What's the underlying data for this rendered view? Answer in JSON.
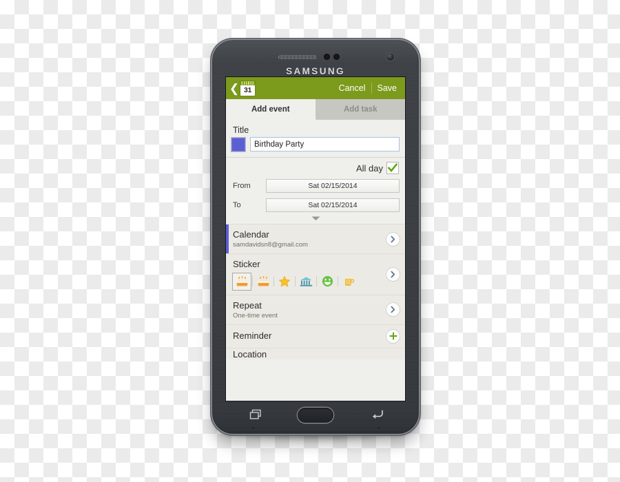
{
  "device": {
    "brand": "SAMSUNG",
    "icons": {
      "earpiece": "earpiece-grille",
      "sensor_left": "proximity-sensor",
      "sensor_right": "light-sensor",
      "front_camera": "front-camera-icon",
      "home": "home-button",
      "recent_apps": "recent-apps-icon",
      "back": "back-icon"
    }
  },
  "actionbar": {
    "back_icon": "back-chevron-icon",
    "calendar_icon": "calendar-icon",
    "calendar_day": "31",
    "cancel_label": "Cancel",
    "save_label": "Save",
    "bg_color": "#7c9a1c"
  },
  "tabs": [
    {
      "label": "Add event",
      "active": true
    },
    {
      "label": "Add task",
      "active": false
    }
  ],
  "form": {
    "title_label": "Title",
    "color_swatch": "#5b5fd4",
    "title_value": "Birthday Party",
    "title_placeholder": "Title",
    "all_day_label": "All day",
    "all_day_checked": true,
    "check_color": "#5aa716",
    "from_label": "From",
    "from_value": "Sat 02/15/2014",
    "to_label": "To",
    "to_value": "Sat 02/15/2014",
    "expand_icon": "chevron-down-icon"
  },
  "list": [
    {
      "name": "calendar",
      "title": "Calendar",
      "subtitle": "samdavidsn8@gmail.com",
      "accent": "#5b5fd4",
      "action_icon": "chevron-right-icon"
    },
    {
      "name": "sticker",
      "title": "Sticker",
      "subtitle": "",
      "action_icon": "chevron-right-icon",
      "stickers": [
        {
          "icon": "birthday-cake-icon",
          "selected": true
        },
        {
          "icon": "birthday-cake-icon",
          "selected": false
        },
        {
          "icon": "star-icon",
          "selected": false
        },
        {
          "icon": "building-icon",
          "selected": false
        },
        {
          "icon": "smiley-face-icon",
          "selected": false
        },
        {
          "icon": "beer-mug-icon",
          "selected": false
        }
      ]
    },
    {
      "name": "repeat",
      "title": "Repeat",
      "subtitle": "One-time event",
      "action_icon": "chevron-right-icon"
    },
    {
      "name": "reminder",
      "title": "Reminder",
      "subtitle": "",
      "action_icon": "plus-icon"
    }
  ],
  "list_cutoff": {
    "title": "Location"
  }
}
